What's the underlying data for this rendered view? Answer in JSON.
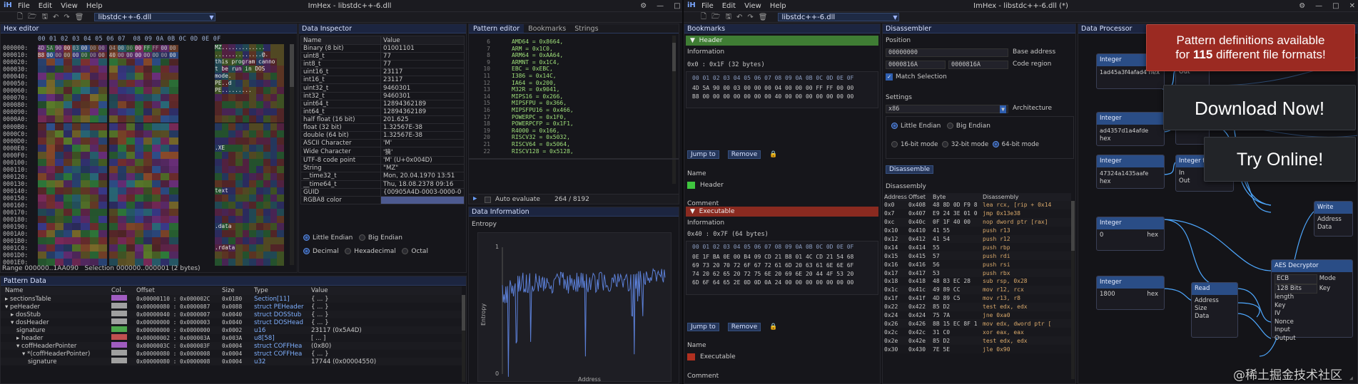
{
  "left_window": {
    "menu": [
      "File",
      "Edit",
      "View",
      "Help"
    ],
    "title": "ImHex - libstdc++-6.dll",
    "file_tab": "libstdc++-6.dll",
    "hex_editor": {
      "tab_label": "Hex editor",
      "col_header": "00 01 02 03 04 05 06 07  08 09 0A 0B 0C 0D 0E 0F",
      "addresses": [
        "000000:",
        "000010:",
        "000020:",
        "000030:",
        "000040:",
        "000050:",
        "000060:",
        "000070:",
        "000080:",
        "000090:",
        "0000A0:",
        "0000B0:",
        "0000C0:",
        "0000D0:",
        "0000E0:",
        "0000F0:",
        "000100:",
        "000110:",
        "000120:",
        "000130:",
        "000140:",
        "000150:",
        "000160:",
        "000170:",
        "000180:",
        "000190:",
        "0001A0:",
        "0001B0:",
        "0001C0:",
        "0001D0:",
        "0001E0:"
      ],
      "visible_bytes": [
        "4D",
        "5A",
        "90",
        "00",
        "03",
        "00",
        "00",
        "00",
        "04",
        "00",
        "00",
        "00",
        "FF",
        "FF",
        "00",
        "00",
        "B8",
        "00",
        "00",
        "00",
        "00",
        "00",
        "00",
        "00",
        "40",
        "00",
        "00",
        "00",
        "00",
        "00",
        "00",
        "00"
      ],
      "ascii_text": [
        "MZ.............",
        "..............@.",
        "this program canno",
        "t be run in DOS",
        "mode.",
        "PE..d",
        "PE.........",
        "",
        "",
        "",
        "",
        "",
        "",
        "",
        ".XE",
        "",
        "",
        "",
        "",
        "",
        "text",
        "",
        "",
        "",
        "",
        ".data",
        "",
        "",
        ".rdata",
        ""
      ],
      "footer_range": "Range 000000..1AA090",
      "footer_selection": "Selection 000000..000001 (2 bytes)"
    },
    "data_inspector": {
      "tab_label": "Data Inspector",
      "headers": [
        "Name",
        "Value"
      ],
      "rows": [
        [
          "Binary (8 bit)",
          "01001101"
        ],
        [
          "uint8_t",
          "77"
        ],
        [
          "int8_t",
          "77"
        ],
        [
          "uint16_t",
          "23117"
        ],
        [
          "int16_t",
          "23117"
        ],
        [
          "uint32_t",
          "9460301"
        ],
        [
          "int32_t",
          "9460301"
        ],
        [
          "uint64_t",
          "12894362189"
        ],
        [
          "int64_t",
          "12894362189"
        ],
        [
          "half float (16 bit)",
          "201.625"
        ],
        [
          "float (32 bit)",
          "1.32567E-38"
        ],
        [
          "double (64 bit)",
          "1.32567E-38"
        ],
        [
          "ASCII Character",
          "'M'"
        ],
        [
          "Wide Character",
          "'獍'"
        ],
        [
          "UTF-8 code point",
          "'M' (U+0x004D)"
        ],
        [
          "String",
          "\"MZ\""
        ],
        [
          "__time32_t",
          "Mon, 20.04.1970 13:51"
        ],
        [
          "__time64_t",
          "Thu, 18.08.2378 09:16"
        ],
        [
          "GUID",
          "{00905A4D-0003-0000-0"
        ],
        [
          "RGBA8 color",
          ""
        ]
      ],
      "radio1": [
        "Little Endian",
        "Big Endian"
      ],
      "radio2": [
        "Decimal",
        "Hexadecimal",
        "Octal"
      ]
    },
    "pattern_editor": {
      "tabs": [
        "Pattern editor",
        "Bookmarks",
        "Strings"
      ],
      "lines": [
        "AMD64 = 0x8664,",
        "ARM = 0x1C0,",
        "ARM64 = 0xAA64,",
        "ARMNT = 0x1C4,",
        "EBC = 0xEBC,",
        "I386 = 0x14C,",
        "IA64 = 0x200,",
        "M32R = 0x9041,",
        "MIPS16 = 0x266,",
        "MIPSFPU = 0x366,",
        "MIPSFPU16 = 0x466,",
        "POWERPC = 0x1F0,",
        "POWERPCFP = 0x1F1,",
        "R4000 = 0x166,",
        "RISCV32 = 0x5032,",
        "RISCV64 = 0x5064,",
        "RISCV128 = 0x5128,"
      ],
      "line_numbers": [
        "6",
        "7",
        "8",
        "9",
        "10",
        "11",
        "12",
        "13",
        "14",
        "15",
        "16",
        "17",
        "18",
        "19",
        "20",
        "21",
        "22"
      ],
      "auto_evaluate": "Auto evaluate",
      "progress": "264 / 8192"
    },
    "data_information": {
      "tab_label": "Data Information",
      "section": "Entropy",
      "ylabel": "Entropy",
      "xlabel": "Address",
      "ytick_1": "1",
      "ytick_0": "0"
    },
    "pattern_data": {
      "tab_label": "Pattern Data",
      "headers": [
        "Name",
        "Col..",
        "Offset",
        "Size",
        "Type",
        "Value"
      ],
      "rows": [
        {
          "name": "sectionsTable",
          "color": "#a05cc0",
          "offset": "0x00000110",
          "end": "0x000002C",
          "size": "0x01B0",
          "type": "Section[11]",
          "value": "{ ... }"
        },
        {
          "name": "peHeader",
          "color": "#a0a0a0",
          "offset": "0x00000080",
          "end": "0x0000087",
          "size": "0x0088",
          "type": "struct PEHeader",
          "value": "{ ... }"
        },
        {
          "name": "dosStub",
          "color": "#a0a0a0",
          "offset": "0x00000040",
          "end": "0x0000007",
          "size": "0x0040",
          "type": "struct DOSStub",
          "value": "{ ... }"
        },
        {
          "name": "dosHeader",
          "color": "#a0a0a0",
          "offset": "0x00000000",
          "end": "0x0000003",
          "size": "0x0040",
          "type": "struct DOSHead",
          "value": "{ ... }"
        },
        {
          "name": "signature",
          "color": "#4ea84e",
          "offset": "0x00000000",
          "end": "0x0000000",
          "size": "0x0002",
          "type": "u16",
          "value": "23117 (0x5A4D)"
        },
        {
          "name": "header",
          "color": "#c05050",
          "offset": "0x00000002",
          "end": "0x000003A",
          "size": "0x003A",
          "type": "u8[58]",
          "value": "[ ... ]"
        },
        {
          "name": "coffHeaderPointer",
          "color": "#a05cc0",
          "offset": "0x0000003C",
          "end": "0x000003F",
          "size": "0x0004",
          "type": "struct COFFHea",
          "value": "(0x80)"
        },
        {
          "name": "*(coffHeaderPointer)",
          "color": "#a0a0a0",
          "offset": "0x00000080",
          "end": "0x0000008",
          "size": "0x0004",
          "type": "struct COFFHea",
          "value": "{ ... }"
        },
        {
          "name": "signature",
          "color": "#a0a0a0",
          "offset": "0x00000080",
          "end": "0x0000008",
          "size": "0x0004",
          "type": "u32",
          "value": "17744 (0x00004550)"
        }
      ]
    }
  },
  "right_window": {
    "menu": [
      "File",
      "Edit",
      "View",
      "Help"
    ],
    "title": "ImHex - libstdc++-6.dll (*)",
    "file_tab": "libstdc++-6.dll",
    "bookmarks": {
      "tab_label": "Bookmarks",
      "header": {
        "title": "Header",
        "info_label": "Information",
        "range": "0x0 : 0x1F (32 bytes)",
        "col_header": "00 01 02 03 04 05 06 07 08 09 0A 0B 0C 0D 0E 0F",
        "hex_lines": [
          "4D 5A 90 00 03 00 00 00 04 00 00 00 FF FF 00 00",
          "B8 00 00 00 00 00 00 00 40 00 00 00 00 00 00 00"
        ],
        "jump": "Jump to",
        "remove": "Remove",
        "name_label": "Name",
        "name_value": "Header",
        "comment_label": "Comment"
      },
      "exec": {
        "title": "Executable",
        "info_label": "Information",
        "range": "0x40 : 0x7F (64 bytes)",
        "col_header": "00 01 02 03 04 05 06 07 08 09 0A 0B 0C 0D 0E 0F",
        "hex_lines": [
          "0E 1F BA 0E 00 B4 09 CD 21 B8 01 4C CD 21 54 68",
          "69 73 20 70 72 6F 67 72 61 6D 20 63 61 6E 6E 6F",
          "74 20 62 65 20 72 75 6E 20 69 6E 20 44 4F 53 20",
          "6D 6F 64 65 2E 0D 0D 0A 24 00 00 00 00 00 00 00"
        ],
        "jump": "Jump to",
        "remove": "Remove",
        "name_label": "Name",
        "name_value": "Executable",
        "comment_label": "Comment"
      }
    },
    "disassembler": {
      "tab_label": "Disassembler",
      "position_label": "Position",
      "base_value": "00000000",
      "base_label": "Base address",
      "region_start": "0000816A",
      "region_end": "0000816A",
      "region_label": "Code region",
      "match_selection": "Match Selection",
      "settings_label": "Settings",
      "arch_value": "x86",
      "arch_label": "Architecture",
      "endian": [
        "Little Endian",
        "Big Endian"
      ],
      "modes": [
        "16-bit mode",
        "32-bit mode",
        "64-bit mode"
      ],
      "disassemble_btn": "Disassemble",
      "disassembly_label": "Disassembly",
      "headers": [
        "Address",
        "Offset",
        "Byte",
        "Disassembly"
      ],
      "rows": [
        [
          "0x0",
          "0x408",
          "48 8D 0D F9 8",
          "lea rcx, [rip + 0x14"
        ],
        [
          "0x7",
          "0x407",
          "E9 24 3E 01 0",
          "jmp 0x13e38"
        ],
        [
          "0xc",
          "0x40c",
          "0F 1F 40 00",
          "nop dword ptr [rax]"
        ],
        [
          "0x10",
          "0x410",
          "41 55",
          "push r13"
        ],
        [
          "0x12",
          "0x412",
          "41 54",
          "push r12"
        ],
        [
          "0x14",
          "0x414",
          "55",
          "push rbp"
        ],
        [
          "0x15",
          "0x415",
          "57",
          "push rdi"
        ],
        [
          "0x16",
          "0x416",
          "56",
          "push rsi"
        ],
        [
          "0x17",
          "0x417",
          "53",
          "push rbx"
        ],
        [
          "0x18",
          "0x418",
          "48 83 EC 28",
          "sub rsp, 0x28"
        ],
        [
          "0x1c",
          "0x41c",
          "49 89 CC",
          "mov r12, rcx"
        ],
        [
          "0x1f",
          "0x41f",
          "4D 89 C5",
          "mov r13, r8"
        ],
        [
          "0x22",
          "0x422",
          "85 D2",
          "test edx, edx"
        ],
        [
          "0x24",
          "0x424",
          "75 7A",
          "jne 0xa0"
        ],
        [
          "0x26",
          "0x426",
          "8B 15 EC 8F 1",
          "mov edx, dword ptr ["
        ],
        [
          "0x2c",
          "0x42c",
          "31 C0",
          "xor eax, eax"
        ],
        [
          "0x2e",
          "0x42e",
          "85 D2",
          "test edx, edx"
        ],
        [
          "0x30",
          "0x430",
          "7E 5E",
          "jle 0x90"
        ]
      ]
    },
    "data_processor": {
      "tab_label": "Data Processor",
      "nodes": {
        "int1": {
          "title": "Integer",
          "value": "1ad45a3f4afad4",
          "suffix": "hex"
        },
        "int2": {
          "title": "Integer",
          "value": "ad4357d1a4afde",
          "suffix": "hex"
        },
        "int3": {
          "title": "Integer",
          "value": "47324a1435aafe",
          "suffix": "hex"
        },
        "int4": {
          "title": "Integer",
          "value": "0",
          "suffix": "hex"
        },
        "int5": {
          "title": "Integer",
          "value": "1800",
          "suffix": "hex"
        },
        "intbuf": {
          "title": "Integer to Buff",
          "in": "In",
          "out": "Out"
        },
        "in1": {
          "title": "In",
          "out": "Out"
        },
        "in2": {
          "title": "In",
          "out": "Out"
        },
        "write": {
          "title": "Write",
          "address": "Address",
          "data": "Data"
        },
        "read": {
          "title": "Read",
          "address": "Address",
          "size": "Size",
          "data": "Data"
        },
        "aes": {
          "title": "AES Decryptor",
          "mode_val": "ECB",
          "mode_lbl": "Mode",
          "bits_val": "128 Bits",
          "bits_lbl": "Key length",
          "ports": [
            "Key",
            "IV",
            "Nonce",
            "Input",
            "Output"
          ]
        }
      }
    },
    "promo": {
      "pattern_line1": "Pattern definitions available",
      "pattern_line2_pre": "for ",
      "pattern_count": "115",
      "pattern_line2_post": " different file formats!",
      "download": "Download Now!",
      "online": "Try Online!"
    },
    "watermark": "@稀土掘金技术社区"
  },
  "colors": {
    "accent": "#3c6ec8",
    "header_green": "#3f7d34",
    "header_red": "#8a2a20",
    "node_header": "#2a4d86",
    "promo_red": "#9b2a22"
  }
}
